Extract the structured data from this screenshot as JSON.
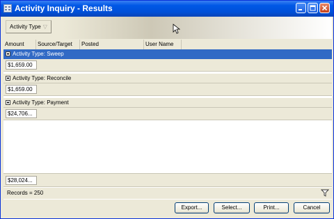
{
  "window": {
    "title": "Activity Inquiry - Results",
    "title_bar_color": "#0054e3",
    "controls": [
      "minimize-icon",
      "maximize-icon",
      "close-icon"
    ]
  },
  "group_by": {
    "chip_label": "Activity Type"
  },
  "columns": [
    "Amount",
    "Source/Target",
    "Posted",
    "User Name"
  ],
  "groups": [
    {
      "label": "Activity Type: Sweep",
      "subtotal": "$1,659.00",
      "selected": true
    },
    {
      "label": "Activity Type: Reconcile",
      "subtotal": "$1,659.00",
      "selected": false
    },
    {
      "label": "Activity Type: Payment",
      "subtotal": "$24,706...",
      "selected": false
    }
  ],
  "grand_total": "$28,024...",
  "status": {
    "records_text": "Records = 250"
  },
  "buttons": {
    "export": "Export...",
    "select": "Select...",
    "print": "Print...",
    "cancel": "Cancel"
  },
  "colors": {
    "selection": "#316ac5",
    "panel": "#ece9d8",
    "border": "#0831d9"
  }
}
